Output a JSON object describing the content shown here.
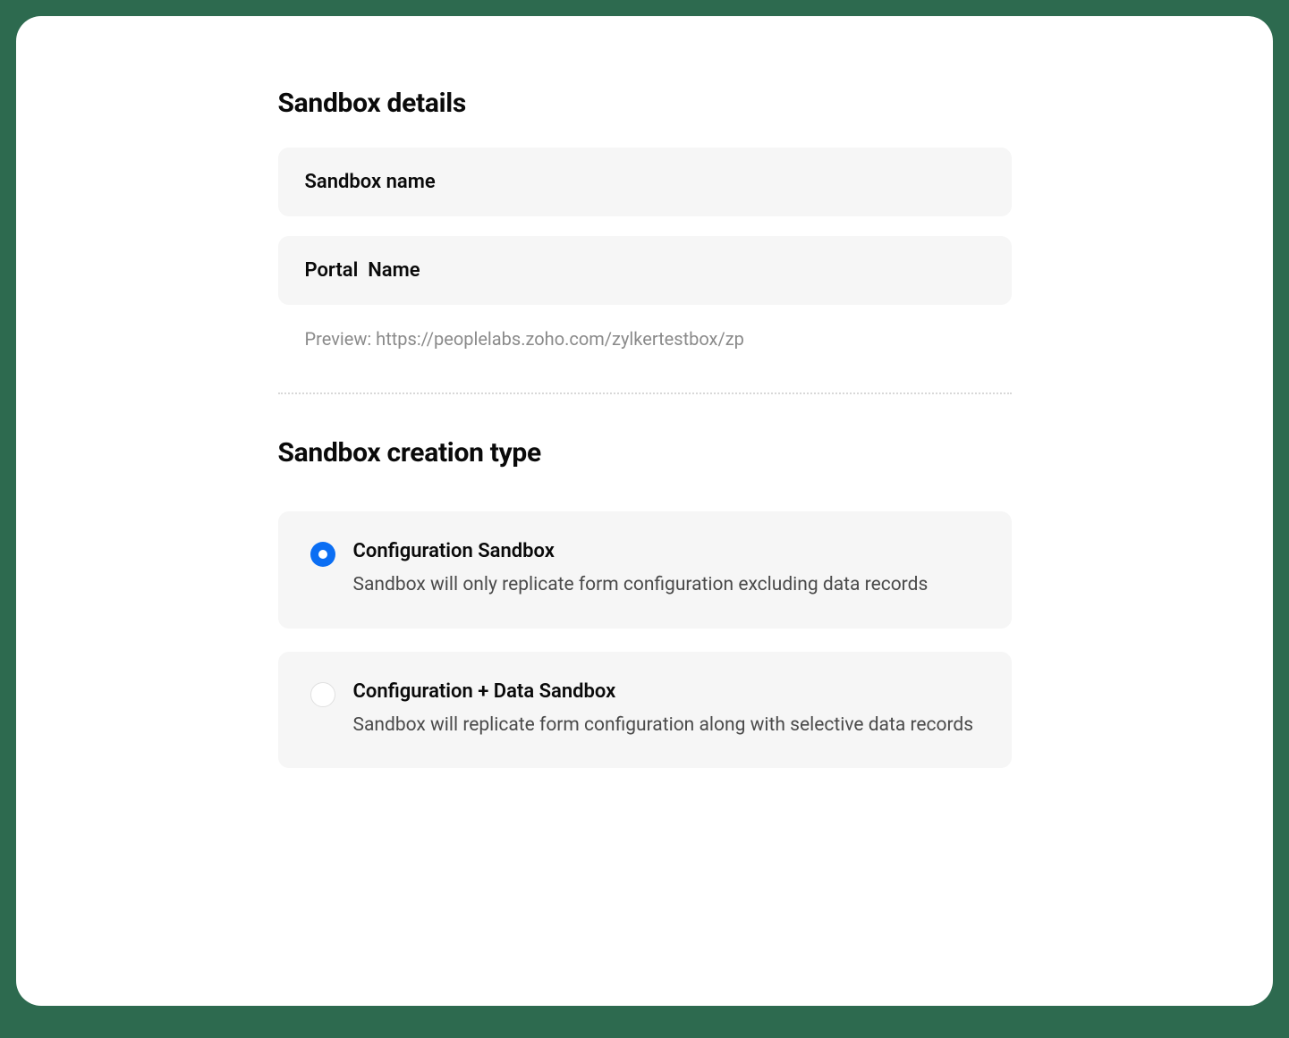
{
  "details": {
    "heading": "Sandbox details",
    "sandbox_name_placeholder": "Sandbox name",
    "portal_name_placeholder": "Portal  Name",
    "preview_text": "Preview: https://peoplelabs.zoho.com/zylkertestbox/zp"
  },
  "creation": {
    "heading": "Sandbox creation type",
    "options": [
      {
        "title": "Configuration Sandbox",
        "description": "Sandbox will only replicate form configuration excluding data records",
        "selected": true
      },
      {
        "title": "Configuration + Data Sandbox",
        "description": "Sandbox will replicate form configuration along with selective data records",
        "selected": false
      }
    ]
  }
}
